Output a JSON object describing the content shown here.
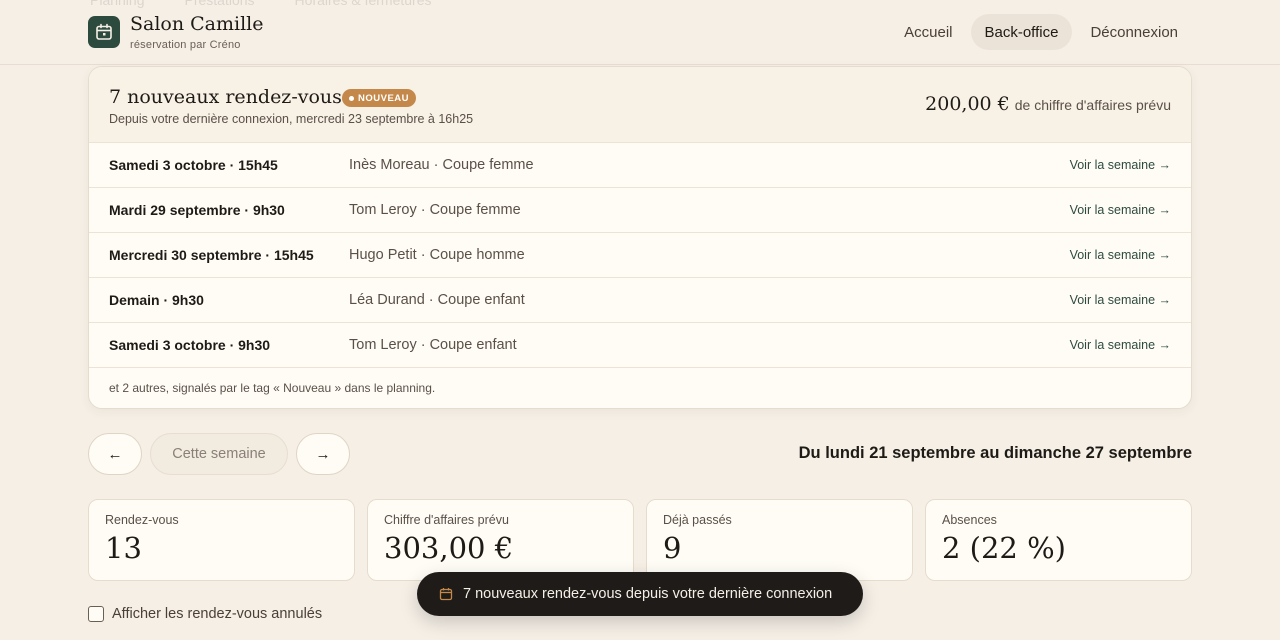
{
  "ghost_tabs": [
    "Planning",
    "Prestations",
    "Horaires & fermetures"
  ],
  "header": {
    "brand_name": "Salon Camille",
    "brand_sub": "réservation par Créno",
    "logo_icon": "calendar-icon",
    "nav": [
      "Accueil",
      "Back-office",
      "Déconnexion"
    ],
    "active_nav": "Back-office"
  },
  "new_card": {
    "title": "7 nouveaux rendez-vous",
    "badge": "NOUVEAU",
    "subtitle": "Depuis votre dernière connexion, mercredi 23 septembre à 16h25",
    "revenue_amount": "200,00 €",
    "revenue_label": "de chiffre d'affaires prévu",
    "rows": [
      {
        "date": "Samedi 3 octobre · 15h45",
        "who": "Inès Moreau · Coupe femme",
        "link": "Voir la semaine →"
      },
      {
        "date": "Mardi 29 septembre · 9h30",
        "who": "Tom Leroy · Coupe femme",
        "link": "Voir la semaine →"
      },
      {
        "date": "Mercredi 30 septembre · 15h45",
        "who": "Hugo Petit · Coupe homme",
        "link": "Voir la semaine →"
      },
      {
        "date": "Demain · 9h30",
        "who": "Léa Durand · Coupe enfant",
        "link": "Voir la semaine →"
      },
      {
        "date": "Samedi 3 octobre · 9h30",
        "who": "Tom Leroy · Coupe enfant",
        "link": "Voir la semaine →"
      }
    ],
    "footer": "et 2 autres, signalés par le tag « Nouveau » dans le planning."
  },
  "week_nav": {
    "prev": "←",
    "current": "Cette semaine",
    "next": "→",
    "range": "Du lundi 21 septembre au dimanche 27 septembre"
  },
  "stats": [
    {
      "label": "Rendez-vous",
      "value": "13"
    },
    {
      "label": "Chiffre d'affaires prévu",
      "value": "303,00 €"
    },
    {
      "label": "Déjà passés",
      "value": "9"
    },
    {
      "label": "Absences",
      "value": "2 (22 %)"
    }
  ],
  "show_cancelled": {
    "label": "Afficher les rendez-vous annulés",
    "checked": false
  },
  "toast": {
    "text": "7 nouveaux rendez-vous depuis votre dernière connexion",
    "icon": "calendar-icon"
  },
  "colors": {
    "accent": "#2d4a3e",
    "badge": "#c4894a",
    "background": "#f5efe6",
    "toast": "#1e1b18"
  }
}
